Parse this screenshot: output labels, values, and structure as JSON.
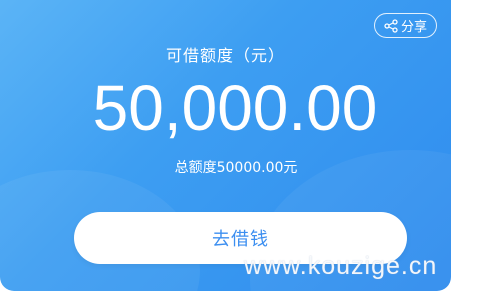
{
  "card": {
    "share_label": "分享",
    "title": "可借额度（元）",
    "amount": "50,000.00",
    "total_label": "总额度50000.00元",
    "borrow_button": "去借钱"
  },
  "watermark": "www.kouzige.cn",
  "icons": {
    "share": "share-icon"
  },
  "colors": {
    "card_gradient_start": "#5bb4f6",
    "card_gradient_end": "#2f8cee",
    "button_text": "#3d8ff0",
    "button_bg": "#ffffff"
  }
}
